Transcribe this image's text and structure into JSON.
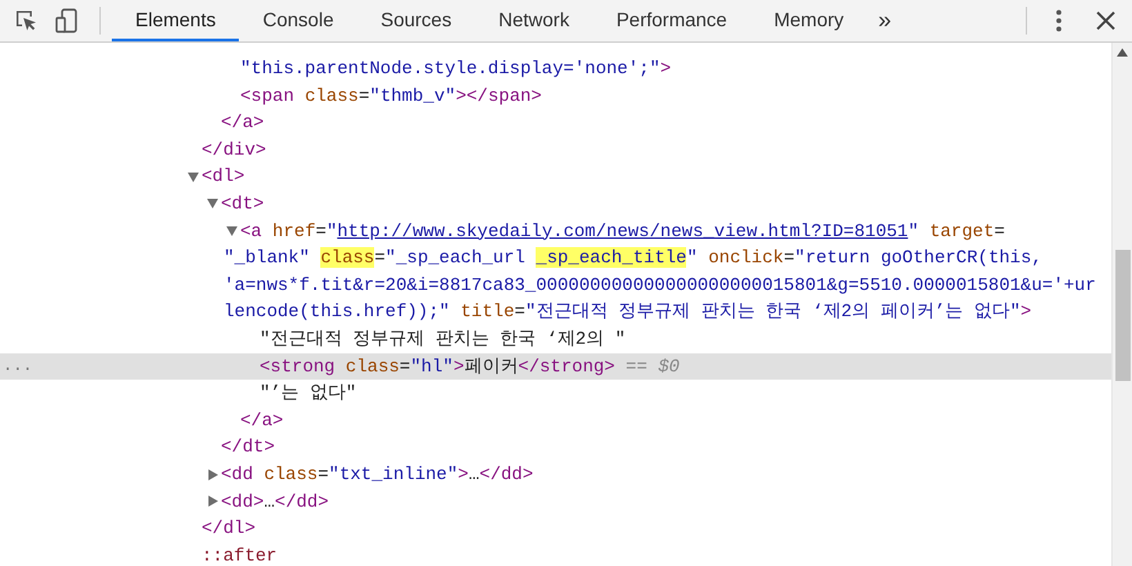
{
  "toolbar": {
    "tabs": [
      {
        "label": "Elements",
        "selected": true
      },
      {
        "label": "Console",
        "selected": false
      },
      {
        "label": "Sources",
        "selected": false
      },
      {
        "label": "Network",
        "selected": false
      },
      {
        "label": "Performance",
        "selected": false
      },
      {
        "label": "Memory",
        "selected": false
      }
    ],
    "overflow": "»"
  },
  "tree": [
    {
      "selected": false,
      "close": [
        {
          "kind": "tag",
          "text": "</div>"
        }
      ],
      "children": [
        {
          "selected": false,
          "close": [
            {
              "kind": "tag",
              "text": "</a>"
            }
          ],
          "children": [
            {
              "selected": false,
              "lines": [
                [
                  {
                    "kind": "val",
                    "text": "\"this.parentNode.style.display='none';\""
                  },
                  {
                    "kind": "tag",
                    "text": ">"
                  }
                ]
              ]
            },
            {
              "selected": false,
              "lines": [
                [
                  {
                    "kind": "tag",
                    "text": "<span"
                  },
                  {
                    "kind": "attr",
                    "text": " class"
                  },
                  {
                    "kind": "text",
                    "text": "="
                  },
                  {
                    "kind": "val",
                    "text": "\"thmb_v\""
                  },
                  {
                    "kind": "tag",
                    "text": "></span>"
                  }
                ]
              ]
            }
          ]
        }
      ]
    },
    {
      "selected": false,
      "expanded": true,
      "lines": [
        [
          {
            "kind": "tag",
            "text": "<dl>"
          }
        ]
      ],
      "close": [
        {
          "kind": "tag",
          "text": "</dl>"
        }
      ],
      "children": [
        {
          "selected": false,
          "expanded": true,
          "lines": [
            [
              {
                "kind": "tag",
                "text": "<dt>"
              }
            ]
          ],
          "close": [
            {
              "kind": "tag",
              "text": "</dt>"
            }
          ],
          "children": [
            {
              "selected": false,
              "expanded": true,
              "lines": [
                [
                  {
                    "kind": "tag",
                    "text": "<a"
                  },
                  {
                    "kind": "attr",
                    "text": " href"
                  },
                  {
                    "kind": "text",
                    "text": "="
                  },
                  {
                    "kind": "val",
                    "text": "\""
                  },
                  {
                    "kind": "link",
                    "text": "http://www.skyedaily.com/news/news_view.html?ID=81051"
                  },
                  {
                    "kind": "val",
                    "text": "\""
                  },
                  {
                    "kind": "attr",
                    "text": " target"
                  },
                  {
                    "kind": "text",
                    "text": "="
                  }
                ],
                [
                  {
                    "kind": "val",
                    "text": "\"_blank\" "
                  },
                  {
                    "kind": "attr",
                    "text": "class",
                    "hl": true
                  },
                  {
                    "kind": "text",
                    "text": "="
                  },
                  {
                    "kind": "val",
                    "text": "\"_sp_each_url "
                  },
                  {
                    "kind": "val",
                    "text": "_sp_each_title",
                    "hl": true
                  },
                  {
                    "kind": "val",
                    "text": "\""
                  },
                  {
                    "kind": "attr",
                    "text": " onclick"
                  },
                  {
                    "kind": "text",
                    "text": "="
                  },
                  {
                    "kind": "val",
                    "text": "\"return goOtherCR(this,"
                  }
                ],
                [
                  {
                    "kind": "val",
                    "text": "'a=nws*f.tit&r=20&i=8817ca83_000000000000000000000015801&g=5510.0000015801&u='+ur"
                  }
                ],
                [
                  {
                    "kind": "val",
                    "text": "lencode(this.href));\""
                  },
                  {
                    "kind": "attr",
                    "text": " title"
                  },
                  {
                    "kind": "text",
                    "text": "="
                  },
                  {
                    "kind": "val",
                    "text": "\"전근대적 정부규제 판치는 한국 ‘제2의 페이커’는 없다\""
                  },
                  {
                    "kind": "tag",
                    "text": ">"
                  }
                ]
              ],
              "close": [
                {
                  "kind": "tag",
                  "text": "</a>"
                }
              ],
              "children": [
                {
                  "selected": false,
                  "lines": [
                    [
                      {
                        "kind": "text",
                        "text": "\"전근대적 정부규제 판치는 한국 ‘제2의 \""
                      }
                    ]
                  ]
                },
                {
                  "selected": true,
                  "dots": "...",
                  "suffix": "== $0",
                  "lines": [
                    [
                      {
                        "kind": "tag",
                        "text": "<strong"
                      },
                      {
                        "kind": "attr",
                        "text": " class"
                      },
                      {
                        "kind": "text",
                        "text": "="
                      },
                      {
                        "kind": "val",
                        "text": "\"hl\""
                      },
                      {
                        "kind": "tag",
                        "text": ">"
                      },
                      {
                        "kind": "text",
                        "text": "페이커"
                      },
                      {
                        "kind": "tag",
                        "text": "</strong>"
                      }
                    ]
                  ]
                },
                {
                  "selected": false,
                  "lines": [
                    [
                      {
                        "kind": "text",
                        "text": "\"’는 없다\""
                      }
                    ]
                  ]
                }
              ]
            }
          ]
        },
        {
          "selected": false,
          "expanded": false,
          "lines": [
            [
              {
                "kind": "tag",
                "text": "<dd"
              },
              {
                "kind": "attr",
                "text": " class"
              },
              {
                "kind": "text",
                "text": "="
              },
              {
                "kind": "val",
                "text": "\"txt_inline\""
              },
              {
                "kind": "tag",
                "text": ">"
              },
              {
                "kind": "text",
                "text": "…"
              },
              {
                "kind": "tag",
                "text": "</dd>"
              }
            ]
          ]
        },
        {
          "selected": false,
          "expanded": false,
          "lines": [
            [
              {
                "kind": "tag",
                "text": "<dd>"
              },
              {
                "kind": "text",
                "text": "…"
              },
              {
                "kind": "tag",
                "text": "</dd>"
              }
            ]
          ]
        }
      ]
    },
    {
      "selected": false,
      "lines": [
        [
          {
            "kind": "pseudo",
            "text": "::after"
          }
        ]
      ]
    }
  ]
}
